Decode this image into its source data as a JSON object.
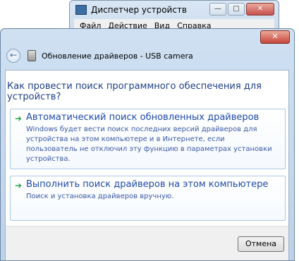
{
  "bg_window": {
    "title": "Диспетчер устройств",
    "menu": [
      "Файл",
      "Действие",
      "Вид",
      "Справка"
    ],
    "controls": {
      "minimize": "—",
      "maximize": "□",
      "close": "✕"
    }
  },
  "dialog": {
    "close": "✕",
    "back_glyph": "←",
    "title": "Обновление драйверов - USB camera",
    "question": "Как провести поиск программного обеспечения для устройств?",
    "options": [
      {
        "arrow": "➜",
        "title": "Автоматический поиск обновленных драйверов",
        "desc": "Windows будет вести поиск последних версий драйверов для устройства на этом компьютере и в Интернете, если пользователь не отключил эту функцию в параметрах установки устройства."
      },
      {
        "arrow": "➜",
        "title": "Выполнить поиск драйверов на этом компьютере",
        "desc": "Поиск и установка драйверов вручную."
      }
    ],
    "cancel": "Отмена"
  },
  "colors": {
    "link_blue": "#1e4aa8",
    "arrow_green": "#2aa84a",
    "close_red": "#c7453a"
  }
}
